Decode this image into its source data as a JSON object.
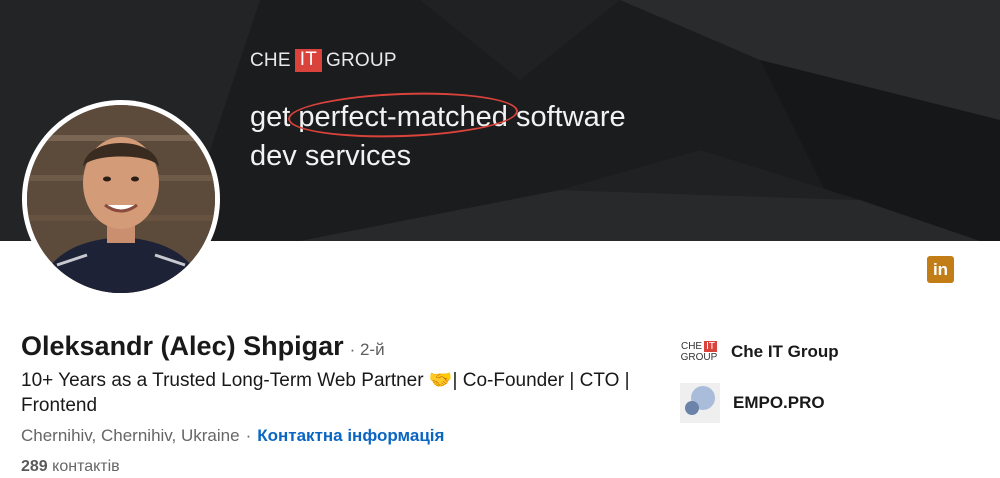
{
  "banner": {
    "brand_che": "CHE",
    "brand_it": "IT",
    "brand_group": "GROUP",
    "tagline_get": "get",
    "tagline_highlight": "perfect-matched",
    "tagline_software": "software",
    "tagline_line2": "dev services"
  },
  "social_badge": "in",
  "profile": {
    "name": "Oleksandr (Alec) Shpigar",
    "degree": "· 2-й",
    "headline": "10+ Years as a Trusted Long-Term Web Partner 🤝| Co-Founder | CTO | Frontend",
    "location": "Chernihiv, Chernihiv, Ukraine",
    "separator": "·",
    "contact_info": "Контактна інформація",
    "connections_count": "289",
    "connections_label": "контактів"
  },
  "companies": [
    {
      "name": "Che IT Group",
      "logo_line1_che": "CHE",
      "logo_line1_it": "IT",
      "logo_line2": "GROUP"
    },
    {
      "name": "EMPO.PRO"
    }
  ],
  "colors": {
    "accent_red": "#d9433b",
    "link_blue": "#0a66c2",
    "linkedin_badge": "#c37d16"
  }
}
